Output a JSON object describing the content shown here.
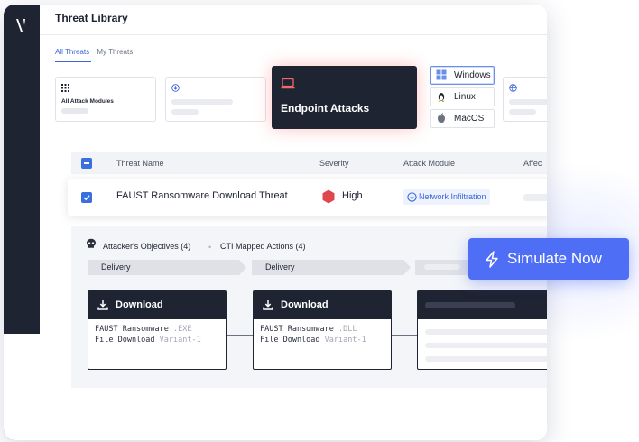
{
  "header": {
    "title": "Threat Library"
  },
  "tabs": [
    {
      "label": "All Threats",
      "active": true
    },
    {
      "label": "My Threats",
      "active": false
    }
  ],
  "modules": {
    "all_label": "All Attack Modules",
    "endpoint_label": "Endpoint Attacks",
    "os_options": [
      {
        "label": "Windows",
        "icon": "windows-icon",
        "active": true
      },
      {
        "label": "Linux",
        "icon": "linux-icon",
        "active": false
      },
      {
        "label": "MacOS",
        "icon": "apple-icon",
        "active": false
      }
    ]
  },
  "table": {
    "columns": [
      "Threat Name",
      "Severity",
      "Attack Module",
      "Affec"
    ],
    "row": {
      "name": "FAUST Ransomware Download Threat",
      "severity": "High",
      "module": "Network Infiltration"
    }
  },
  "detail": {
    "objectives": "Attacker's Objectives (4)",
    "cti": "CTI Mapped Actions (4)",
    "phases": [
      "Delivery",
      "Delivery"
    ],
    "steps": [
      {
        "title": "Download",
        "line1": "FAUST Ransomware",
        "ext": ".EXE",
        "line2": "File Download",
        "variant": "Variant-1"
      },
      {
        "title": "Download",
        "line1": "FAUST Ransomware",
        "ext": ".DLL",
        "line2": "File Download",
        "variant": "Variant-1"
      }
    ]
  },
  "cta": {
    "label": "Simulate Now"
  },
  "colors": {
    "accent": "#4d6ef5",
    "dark": "#1f2433",
    "severity_high": "#e0474c",
    "link": "#3a65d6"
  }
}
